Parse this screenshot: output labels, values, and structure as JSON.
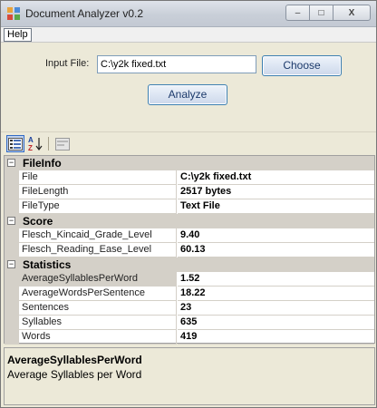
{
  "window": {
    "title": "Document Analyzer v0.2",
    "icon": "app-icon",
    "controls": {
      "minimize": "–",
      "maximize": "□",
      "close": "X"
    }
  },
  "menu": {
    "items": [
      {
        "label": "Help"
      }
    ]
  },
  "form": {
    "input_label": "Input File:",
    "input_value": "C:\\y2k fixed.txt",
    "choose_label": "Choose",
    "analyze_label": "Analyze"
  },
  "toolbar": {
    "icons": [
      "categorized-view-icon",
      "alphabetical-sort-icon",
      "property-pages-icon"
    ]
  },
  "property_grid": {
    "categories": [
      {
        "name": "FileInfo",
        "toggle": "−",
        "properties": [
          {
            "name": "File",
            "value": "C:\\y2k fixed.txt"
          },
          {
            "name": "FileLength",
            "value": "2517 bytes"
          },
          {
            "name": "FileType",
            "value": "Text File"
          }
        ]
      },
      {
        "name": "Score",
        "toggle": "−",
        "properties": [
          {
            "name": "Flesch_Kincaid_Grade_Level",
            "value": "9.40"
          },
          {
            "name": "Flesch_Reading_Ease_Level",
            "value": "60.13"
          }
        ]
      },
      {
        "name": "Statistics",
        "toggle": "−",
        "properties": [
          {
            "name": "AverageSyllablesPerWord",
            "value": "1.52",
            "selected": true
          },
          {
            "name": "AverageWordsPerSentence",
            "value": "18.22"
          },
          {
            "name": "Sentences",
            "value": "23"
          },
          {
            "name": "Syllables",
            "value": "635"
          },
          {
            "name": "Words",
            "value": "419"
          }
        ]
      }
    ]
  },
  "description": {
    "title": "AverageSyllablesPerWord",
    "text": "Average Syllables per Word"
  },
  "colors": {
    "window_bg": "#ece9d8",
    "category_bg": "#d4d0c8",
    "button_border": "#3c7fb1",
    "input_border": "#7f9db9"
  }
}
